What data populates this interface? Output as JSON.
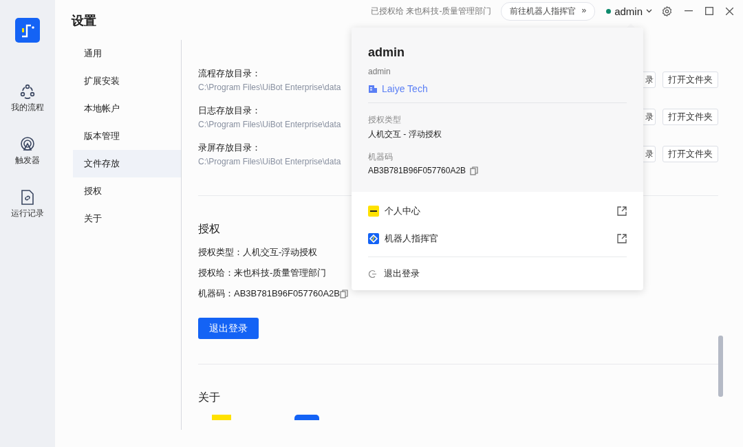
{
  "rail": {
    "nav": [
      {
        "label": "我的流程",
        "kind": "flow"
      },
      {
        "label": "触发器",
        "kind": "trigger"
      },
      {
        "label": "运行记录",
        "kind": "log"
      }
    ]
  },
  "header": {
    "title": "设置",
    "license_note": "已授权给 来也科技-质量管理部门",
    "commander_button": "前往机器人指挥官",
    "commander_arrow": "»",
    "user": {
      "name": "admin",
      "online": true
    }
  },
  "settings_nav": [
    {
      "label": "通用",
      "selected": false
    },
    {
      "label": "扩展安装",
      "selected": false
    },
    {
      "label": "本地帐户",
      "selected": false
    },
    {
      "label": "版本管理",
      "selected": false
    },
    {
      "label": "文件存放",
      "selected": true
    },
    {
      "label": "授权",
      "selected": false
    },
    {
      "label": "关于",
      "selected": false
    }
  ],
  "directories": [
    {
      "label": "流程存放目录：",
      "path": "C:\\Program Files\\UiBot Enterprise\\data",
      "change_button": "录",
      "open_button": "打开文件夹"
    },
    {
      "label": "日志存放目录：",
      "path": "C:\\Program Files\\UiBot Enterprise\\data",
      "change_button": "录",
      "open_button": "打开文件夹"
    },
    {
      "label": "录屏存放目录：",
      "path": "C:\\Program Files\\UiBot Enterprise\\data",
      "change_button": "录",
      "open_button": "打开文件夹"
    }
  ],
  "license": {
    "title": "授权",
    "fields": [
      {
        "label": "授权类型：",
        "value": "人机交互-浮动授权"
      },
      {
        "label": "授权给：",
        "value": "来也科技-质量管理部门"
      },
      {
        "label": "机器码：",
        "value": "AB3B781B96F057760A2B",
        "copyable": true
      }
    ],
    "logout_button": "退出登录"
  },
  "about": {
    "title": "关于"
  },
  "user_popup": {
    "name": "admin",
    "account": "admin",
    "organization": "Laiye Tech",
    "license_type_label": "授权类型",
    "license_type": "人机交互 - 浮动授权",
    "machine_code_label": "机器码",
    "machine_code": "AB3B781B96F057760A2B",
    "links": [
      {
        "label": "个人中心",
        "kind": "laiye"
      },
      {
        "label": "机器人指挥官",
        "kind": "commander"
      }
    ],
    "logout": "退出登录"
  }
}
